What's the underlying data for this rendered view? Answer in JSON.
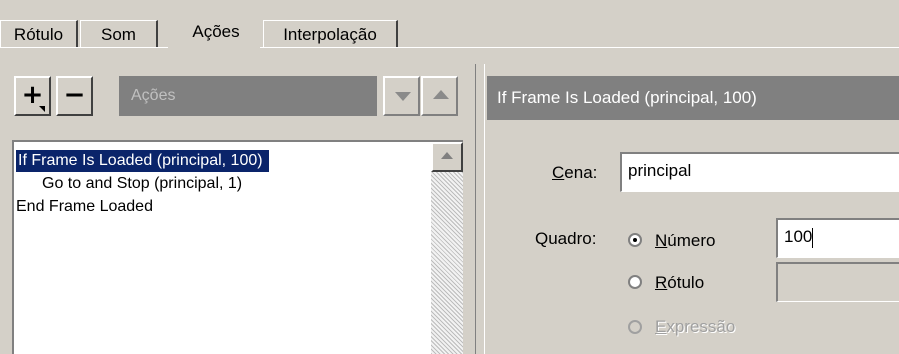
{
  "tabs": [
    {
      "label": "Rótulo"
    },
    {
      "label": "Som"
    },
    {
      "label": "Ações",
      "active": true
    },
    {
      "label": "Interpolação"
    }
  ],
  "toolbar": {
    "add_label": "+",
    "remove_label": "−",
    "actions_combo": "Ações"
  },
  "actions_list": [
    {
      "text": "If Frame Is Loaded (principal, 100)",
      "selected": true
    },
    {
      "text": "Go to and Stop (principal, 1)"
    },
    {
      "text": "End Frame Loaded"
    }
  ],
  "detail": {
    "header": "If Frame Is Loaded (principal, 100)",
    "scene_label": "Cena:",
    "scene_value": "principal",
    "frame_label": "Quadro:",
    "options": [
      {
        "label": "Número",
        "checked": true,
        "enabled": true
      },
      {
        "label": "Rótulo",
        "checked": false,
        "enabled": true
      },
      {
        "label": "Expressão",
        "checked": false,
        "enabled": false
      }
    ],
    "number_value": "100",
    "label_value": ""
  },
  "icons": [
    "add-icon",
    "remove-icon",
    "move-down-icon",
    "move-up-icon",
    "scroll-up-icon"
  ],
  "colors": {
    "face": "#d4d0c8",
    "selection": "#0a246a",
    "header_gray": "#808080"
  }
}
